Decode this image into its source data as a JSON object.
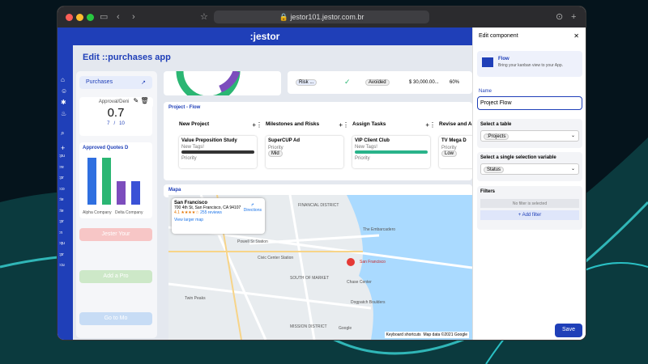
{
  "browser": {
    "url": "jestor101.jestor.com.br"
  },
  "app": {
    "brand": ":jestor",
    "edit_title": "Edit ::purchases app"
  },
  "sidebar": {
    "items": [
      ":pu",
      ":re",
      ":pr",
      ":co",
      ":te",
      ":te",
      ":pr",
      ":n",
      ":qu",
      ":pr",
      ":cu"
    ]
  },
  "left": {
    "purchases": "Purchases",
    "approval_label": "Approval/Denial",
    "approval_value": "0.7",
    "approval_n": "7",
    "approval_sep": "/",
    "approval_d": "10",
    "quotes_title": "Approved Quotes D",
    "bar_labels": [
      "Alpha Company",
      "Delta Company"
    ],
    "btn1": "Jester Your",
    "btn2": "Add a Pro",
    "btn3": "Go to Mo"
  },
  "chart_data": {
    "type": "bar",
    "categories": [
      "Alpha Company",
      "",
      "Delta Company",
      ""
    ],
    "values": [
      2,
      2,
      1,
      1
    ],
    "ylim": [
      0,
      2
    ]
  },
  "top": {
    "risk": "Risk ...",
    "status": "Avoided",
    "amount": "$ 30,000.00...",
    "pct": "60%"
  },
  "flow": {
    "title": "Project - Flow",
    "columns": [
      {
        "name": "New Project",
        "card_title": "Value Preposition Study",
        "tags_label": "New Tags!",
        "field_label": "Priority"
      },
      {
        "name": "Milestones and Risks",
        "card_title": "SuperCUP Ad",
        "field_label": "Priority",
        "field_value": "Mid"
      },
      {
        "name": "Assign Tasks",
        "card_title": "VIP Client Club",
        "tags_label": "New Tags!",
        "field_label": "Priority"
      },
      {
        "name": "Revise and Ac",
        "card_title": "TV Mega D",
        "field_label": "Priority",
        "field_value": "Low"
      }
    ]
  },
  "map": {
    "title": "Mapa",
    "place": "San Francisco",
    "address": "700 4th St, San Francisco, CA 94107",
    "rating": "4.1",
    "stars": "★★★★☆",
    "reviews": "255 reviews",
    "larger": "View larger map",
    "directions": "Directions",
    "pin_label": "San Francisco",
    "footer_keys": "Keyboard shortcuts",
    "footer_data": "Map data ©2021 Google",
    "labels": [
      "FINANCIAL DISTRICT",
      "Powell St Station",
      "Civic Center Station",
      "The Embarcadero",
      "SOUTH OF MARKET",
      "Chase Center",
      "Dogpatch Boulders",
      "MISSION DISTRICT",
      "Twin Peaks",
      "Google"
    ]
  },
  "panel": {
    "title": "Edit component",
    "comp_name": "Flow",
    "comp_desc": "Bring your kanban view to your App.",
    "name_label": "Name",
    "name_value": "Project Flow",
    "table_label": "Select a table",
    "table_value": ":Projects",
    "var_label": "Select a single selection variable",
    "var_value": "Status",
    "filters_label": "Filters",
    "no_filter": "No filter is selected",
    "add_filter": "+ Add filter",
    "save": "Save"
  }
}
